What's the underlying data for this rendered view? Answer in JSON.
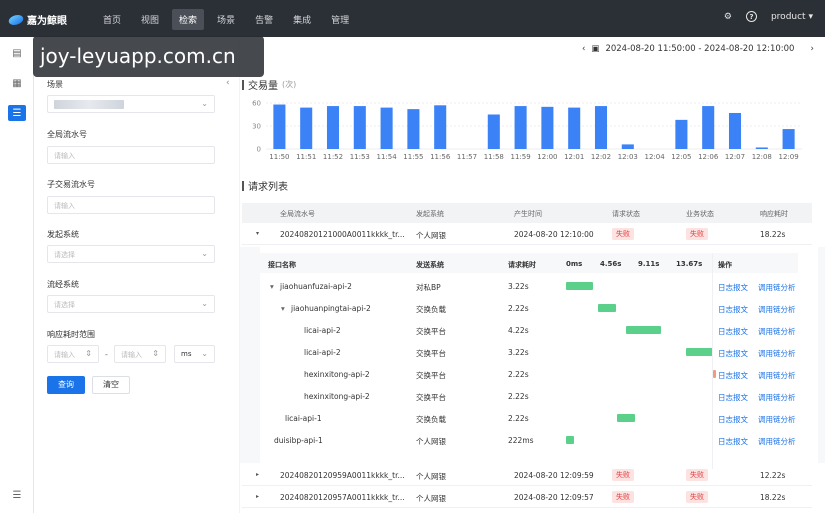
{
  "app": {
    "name": "嘉为鲸眼"
  },
  "nav": {
    "items": [
      "首页",
      "视图",
      "检索",
      "场景",
      "告警",
      "集成",
      "管理"
    ],
    "active": "检索"
  },
  "topbar": {
    "user": "product"
  },
  "watermark": "joy-leyuapp.com.cn",
  "filters": {
    "scene_label": "场景",
    "global_id_label": "全局流水号",
    "global_id_placeholder": "请输入",
    "sub_id_label": "子交易流水号",
    "sub_id_placeholder": "请输入",
    "origin_label": "发起系统",
    "origin_placeholder": "请选择",
    "flow_label": "流经系统",
    "flow_placeholder": "请选择",
    "range_label": "响应耗时范围",
    "range_min_placeholder": "请输入",
    "range_max_placeholder": "请输入",
    "range_sep": "-",
    "range_unit": "ms",
    "query_button": "查询",
    "clear_button": "清空"
  },
  "date_range": "2024-08-20 11:50:00 - 2024-08-20 12:10:00",
  "volume": {
    "title": "交易量",
    "unit": "(次)"
  },
  "chart_data": {
    "type": "bar",
    "categories": [
      "11:50",
      "11:51",
      "11:52",
      "11:53",
      "11:54",
      "11:55",
      "11:56",
      "11:57",
      "11:58",
      "11:59",
      "12:00",
      "12:01",
      "12:02",
      "12:03",
      "12:04",
      "12:05",
      "12:06",
      "12:07",
      "12:08",
      "12:09"
    ],
    "values": [
      58,
      54,
      56,
      56,
      54,
      52,
      57,
      0,
      45,
      56,
      55,
      54,
      56,
      6,
      0,
      38,
      56,
      47,
      2,
      26
    ],
    "ylim": [
      0,
      60
    ],
    "yticks": [
      0,
      30,
      60
    ],
    "color": "#3b82f6"
  },
  "requests": {
    "title": "请求列表",
    "headers": [
      "全局流水号",
      "发起系统",
      "产生时间",
      "请求状态",
      "业务状态",
      "响应耗时"
    ],
    "rows": [
      {
        "id": "20240820121000A0011kkkk_tr...",
        "system": "个人网银",
        "time": "2024-08-20 12:10:00",
        "req_status": "失败",
        "biz_status": "失败",
        "duration": "18.22s"
      },
      {
        "id": "20240820120959A0011kkkk_tr...",
        "system": "个人网银",
        "time": "2024-08-20 12:09:59",
        "req_status": "失败",
        "biz_status": "失败",
        "duration": "12.22s"
      },
      {
        "id": "20240820120957A0011kkkk_tr...",
        "system": "个人网银",
        "time": "2024-08-20 12:09:57",
        "req_status": "失败",
        "biz_status": "失败",
        "duration": "18.22s"
      }
    ]
  },
  "detail": {
    "headers": [
      "接口名称",
      "发送系统",
      "请求耗时",
      "0ms",
      "4.56s",
      "9.11s",
      "13.67s",
      "操作"
    ],
    "rows": [
      {
        "name": "jiaohuanfuzai-api-2",
        "indent": 0,
        "tree": "▾",
        "system": "对私BP",
        "duration": "3.22s",
        "start": 0.0,
        "span": 0.177
      },
      {
        "name": "jiaohuanpingtai-api-2",
        "indent": 1,
        "tree": "▾",
        "system": "交换负载",
        "duration": "2.22s",
        "start": 0.211,
        "span": 0.122
      },
      {
        "name": "licai-api-2",
        "indent": 2,
        "tree": "",
        "system": "交换平台",
        "duration": "4.22s",
        "start": 0.4,
        "span": 0.23
      },
      {
        "name": "licai-api-2",
        "indent": 2,
        "tree": "",
        "system": "交换平台",
        "duration": "3.22s",
        "start": 0.8,
        "span": 0.177
      },
      {
        "name": "hexinxitong-api-2",
        "indent": 2,
        "tree": "",
        "system": "交换平台",
        "duration": "2.22s",
        "start": 0.98,
        "span": 0.02
      },
      {
        "name": "hexinxitong-api-2",
        "indent": 2,
        "tree": "",
        "system": "交换平台",
        "duration": "2.22s",
        "start": 0.0,
        "span": 0.0
      },
      {
        "name": "licai-api-1",
        "indent": 1,
        "tree": "",
        "system": "交换负载",
        "duration": "2.22s",
        "start": 0.34,
        "span": 0.12
      },
      {
        "name": "duisibp-api-1",
        "indent": 0,
        "tree": "",
        "system": "个人网银",
        "duration": "222ms",
        "start": 0.0,
        "span": 0.055
      }
    ],
    "op_log": "日志报文",
    "op_trace": "调用链分析"
  }
}
